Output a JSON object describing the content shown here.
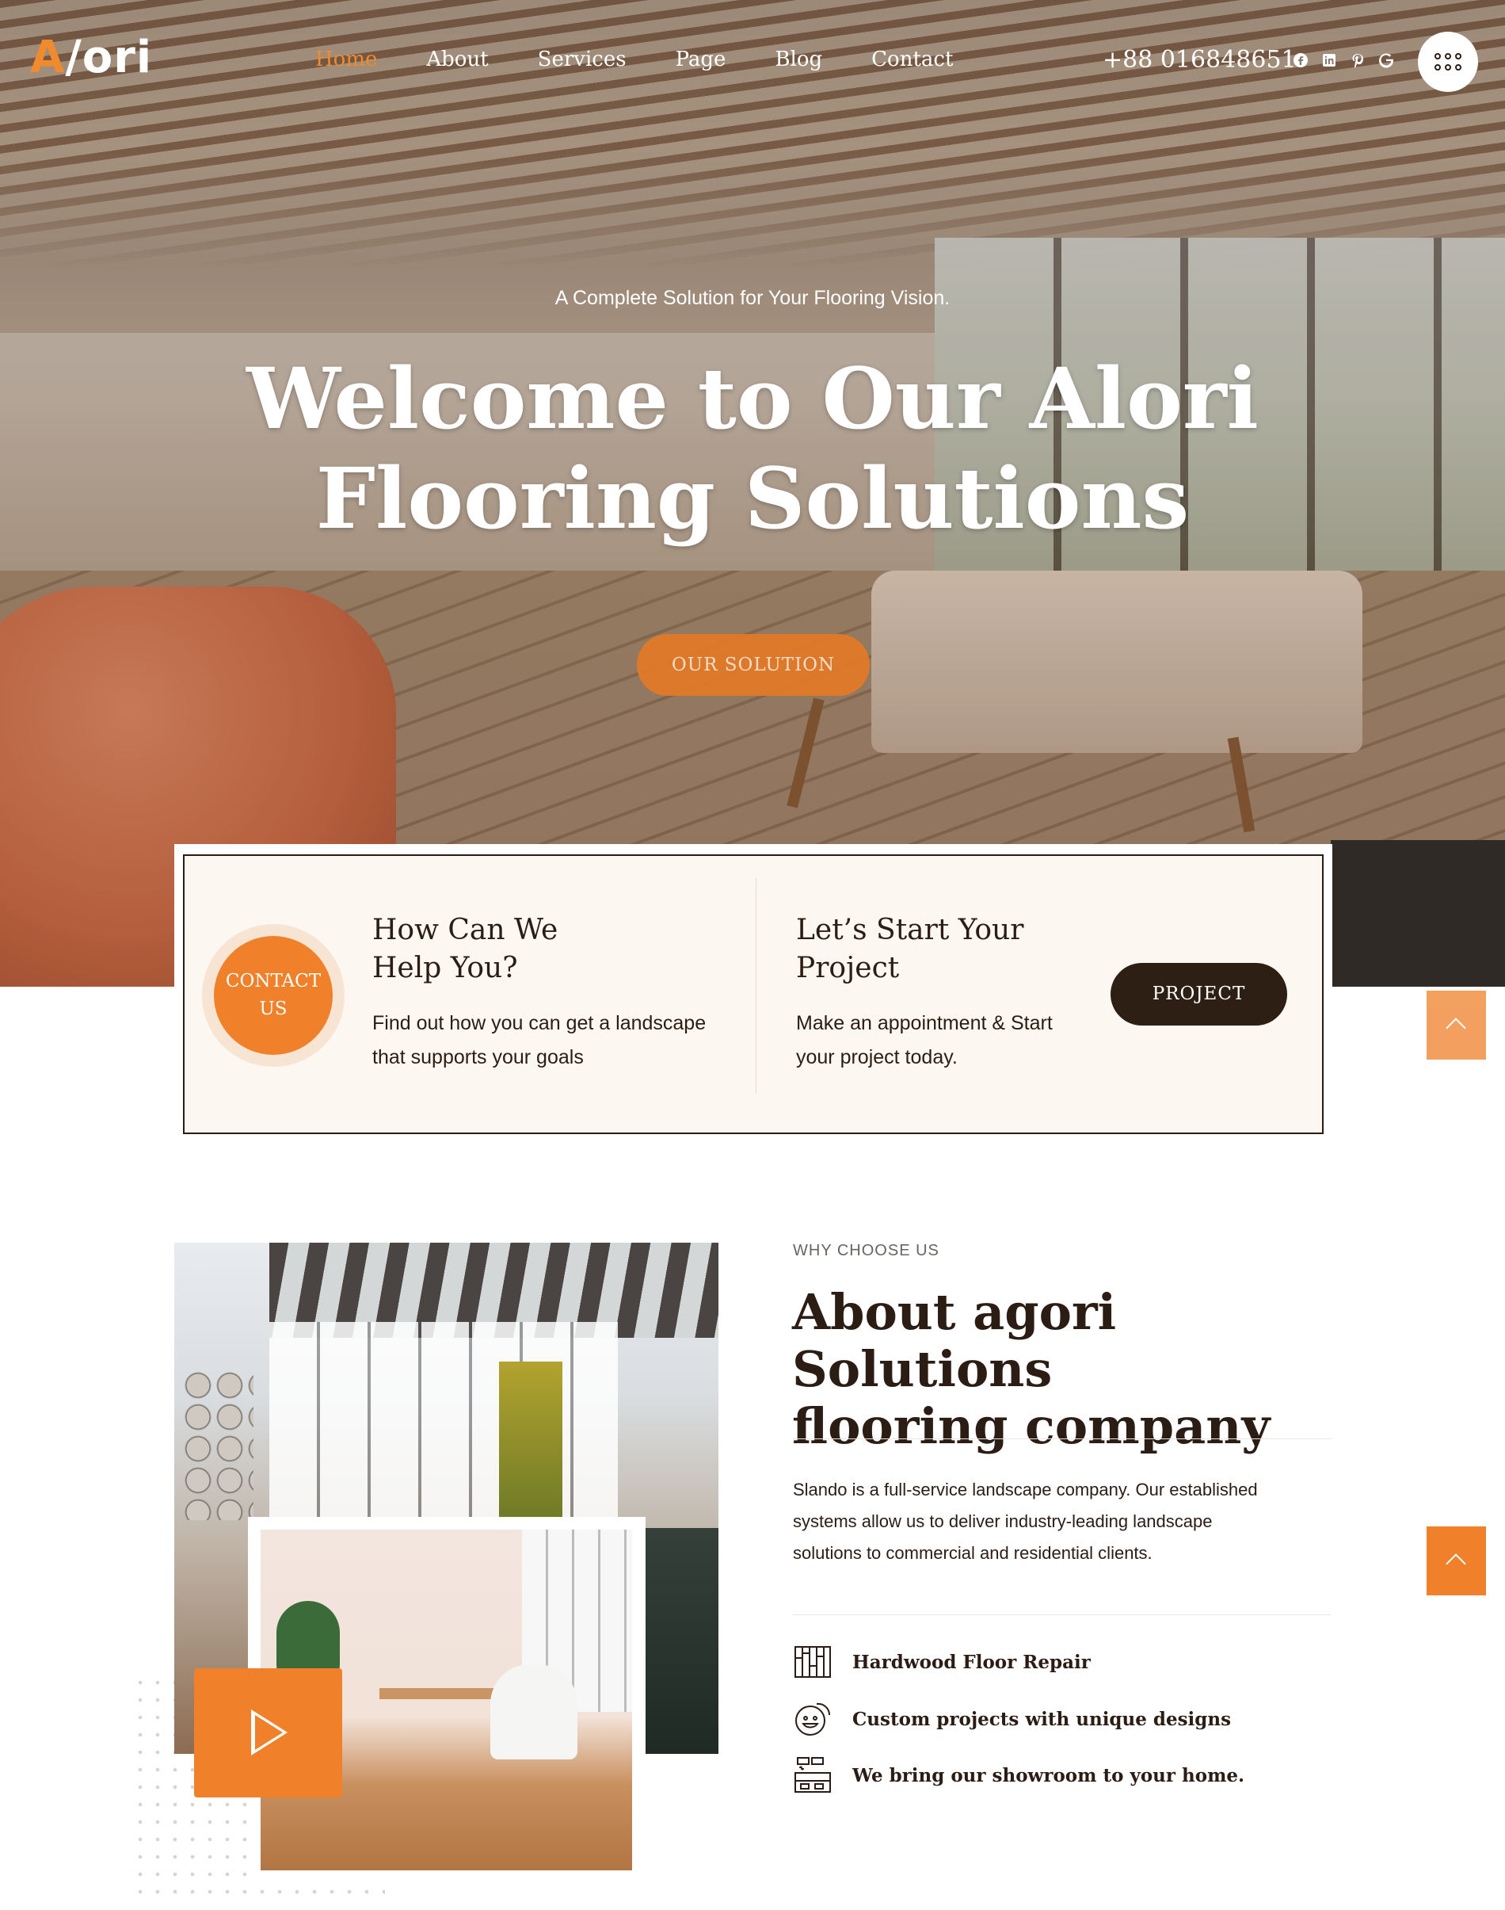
{
  "brand": {
    "logo_prefix": "A",
    "logo_rest": "/ori",
    "accent_color": "#f08a2e",
    "dark_color": "#2b1d14"
  },
  "nav": {
    "items": [
      {
        "label": "Home",
        "active": true
      },
      {
        "label": "About"
      },
      {
        "label": "Services"
      },
      {
        "label": "Page"
      },
      {
        "label": "Blog"
      },
      {
        "label": "Contact"
      }
    ]
  },
  "header": {
    "phone": "+88 016848651",
    "socials": [
      "facebook-icon",
      "linkedin-icon",
      "pinterest-icon",
      "google-icon"
    ],
    "menu_icon": "grid-dots-icon"
  },
  "hero": {
    "subtitle": "A Complete Solution for Your Flooring Vision.",
    "title_line1": "Welcome to Our Alori",
    "title_line2": "Flooring Solutions",
    "cta_label": "OUR SOLUTION"
  },
  "info_card": {
    "contact_line1": "CONTACT",
    "contact_line2": "US",
    "help_title_line1": "How Can We",
    "help_title_line2": "Help You?",
    "help_text_line1": "Find out how you can get a landscape",
    "help_text_line2": "that supports your goals",
    "project_title_line1": "Let’s Start Your",
    "project_title_line2": "Project",
    "project_text_line1": "Make an appointment & Start",
    "project_text_line2": "your project today.",
    "project_button": "PROJECT"
  },
  "about": {
    "eyebrow": "WHY CHOOSE US",
    "title_line1": "About agori Solutions",
    "title_line2": "flooring company",
    "text_line1": "Slando is a full-service landscape company. Our established",
    "text_line2": "systems allow us to deliver industry-leading landscape",
    "text_line3": "solutions to commercial and residential clients.",
    "features": [
      {
        "icon": "hardwood-floor-icon",
        "label": "Hardwood Floor Repair"
      },
      {
        "icon": "happy-face-icon",
        "label": "Custom projects with unique designs"
      },
      {
        "icon": "showroom-icon",
        "label": "We bring our showroom to your home."
      }
    ],
    "play_icon": "play-icon"
  },
  "scroll_top_icon": "chevron-up-icon"
}
